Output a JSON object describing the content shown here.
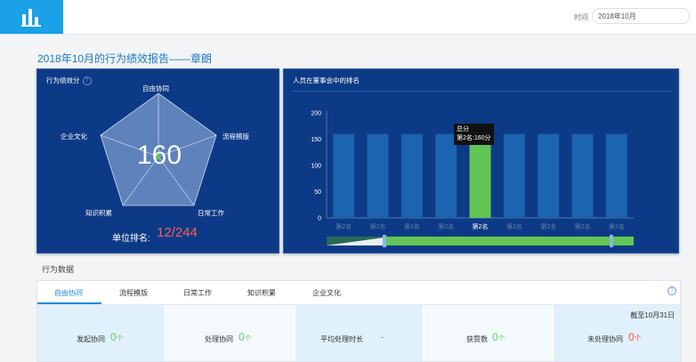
{
  "header": {
    "time_label": "时间",
    "time_value": "2018年10月"
  },
  "report_title": "2018年10月的行为绩效报告——章朗",
  "radar_panel": {
    "title": "行为绩效分",
    "score": "160",
    "axes": [
      "自由协同",
      "流程模版",
      "日常工作",
      "知识积累",
      "企业文化"
    ],
    "rank_label": "单位排名:",
    "rank_value": "12/244"
  },
  "ranking_panel": {
    "title": "人员在董事会中的排名",
    "tooltip_line1": "总分",
    "tooltip_line2": "第2名:160分",
    "highlight_color": "#62c554",
    "bar_color": "#1c63b0"
  },
  "chart_data": {
    "type": "bar",
    "categories": [
      "第2名",
      "第2名",
      "第2名",
      "第2名",
      "第2名",
      "第2名",
      "第2名",
      "第2名",
      "第2名"
    ],
    "values": [
      160,
      160,
      160,
      160,
      160,
      160,
      160,
      160,
      160
    ],
    "highlight_index": 4,
    "ylim": [
      0,
      200
    ],
    "yticks": [
      0,
      50,
      100,
      150,
      200
    ]
  },
  "section_label": "行为数据",
  "tabs": [
    "自由协同",
    "流程模版",
    "日常工作",
    "知识积累",
    "企业文化"
  ],
  "deadline": "截至10月31日",
  "stats": [
    {
      "label": "发起协同",
      "value": "0",
      "unit": "个",
      "color": "#6ac96a"
    },
    {
      "label": "处理协同",
      "value": "0",
      "unit": "个",
      "color": "#6ac96a"
    },
    {
      "label": "平均处理时长",
      "value": "-",
      "unit": "",
      "color": "#6ac96a"
    },
    {
      "label": "获赞数",
      "value": "0",
      "unit": "个",
      "color": "#6ac96a"
    },
    {
      "label": "未处理协同",
      "value": "0",
      "unit": "个",
      "color": "#ff4d4d"
    }
  ]
}
